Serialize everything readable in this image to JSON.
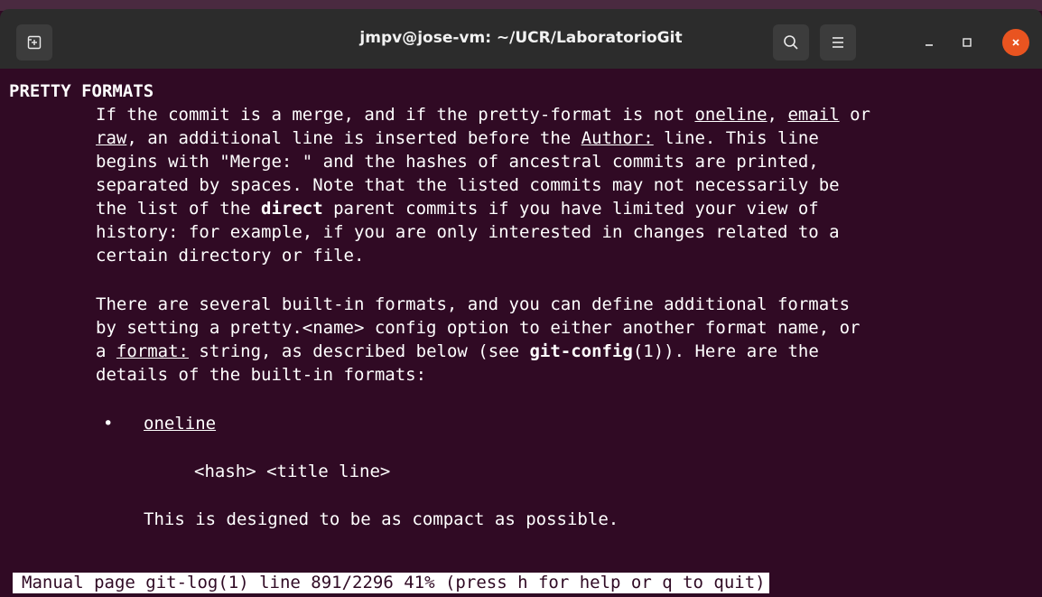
{
  "window": {
    "title": "jmpv@jose-vm: ~/UCR/LaboratorioGit"
  },
  "titlebar": {
    "new_tab_icon": "new-tab-icon",
    "search_icon": "search-icon",
    "menu_icon": "hamburger-menu-icon",
    "minimize_icon": "minimize-icon",
    "maximize_icon": "maximize-icon",
    "close_icon": "close-icon",
    "close_color": "#e95420"
  },
  "colors": {
    "terminal_bg": "#300a24",
    "terminal_fg": "#ffffff",
    "titlebar_bg": "#2c2c2c"
  },
  "manpage": {
    "section_heading": "PRETTY FORMATS",
    "p1": {
      "l1a": "If the commit is a merge, and if the pretty-format is not ",
      "l1_oneline": "oneline",
      "l1b": ", ",
      "l1_email": "email",
      "l1c": " or",
      "l2_raw": "raw",
      "l2a": ", an additional line is inserted before the ",
      "l2_author": "Author:",
      "l2b": " line. This line",
      "l3": "begins with \"Merge: \" and the hashes of ancestral commits are printed,",
      "l4": "separated by spaces. Note that the listed commits may not necessarily be",
      "l5a": "the list of the ",
      "l5_direct": "direct",
      "l5b": " parent commits if you have limited your view of",
      "l6": "history: for example, if you are only interested in changes related to a",
      "l7": "certain directory or file."
    },
    "p2": {
      "l1": "There are several built-in formats, and you can define additional formats",
      "l2": "by setting a pretty.<name> config option to either another format name, or",
      "l3a": "a ",
      "l3_format": "format:",
      "l3b": " string, as described below (see ",
      "l3_gitconfig": "git-config",
      "l3c": "(1)). Here are the",
      "l4": "details of the built-in formats:"
    },
    "list": {
      "bullet": "•",
      "item1_label": "oneline",
      "item1_example": "<hash> <title line>",
      "item1_desc": "This is designed to be as compact as possible."
    }
  },
  "status": {
    "text": "Manual page git-log(1) line 891/2296 41% (press h for help or q to quit)"
  }
}
